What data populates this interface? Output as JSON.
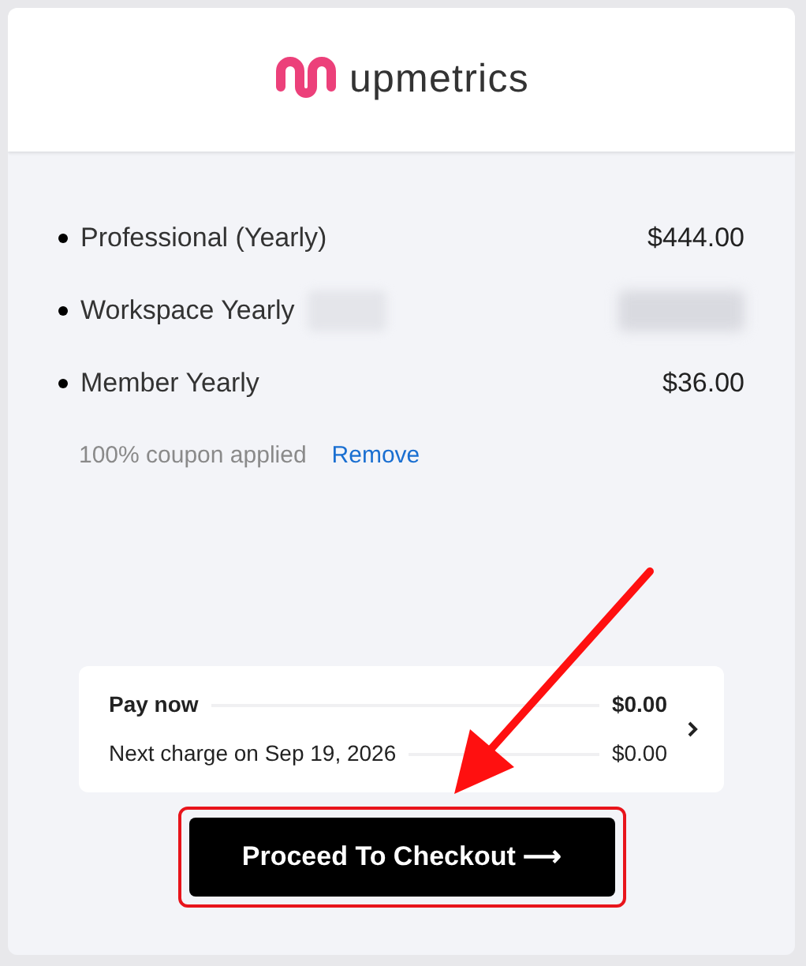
{
  "logo": {
    "text": "upmetrics"
  },
  "items": [
    {
      "name": "Professional (Yearly)",
      "price": "$444.00",
      "redacted": false
    },
    {
      "name": "Workspace Yearly",
      "redacted": true
    },
    {
      "name": "Member Yearly",
      "price": "$36.00",
      "redacted": false
    }
  ],
  "coupon": {
    "text": "100% coupon applied",
    "link": "Remove"
  },
  "summary": {
    "rows": [
      {
        "label": "Pay now",
        "amount": "$0.00",
        "bold": true
      },
      {
        "label": "Next charge on Sep 19, 2026",
        "amount": "$0.00",
        "bold": false
      }
    ]
  },
  "checkout_button": {
    "label": "Proceed To Checkout ⟶",
    "highlighted": true
  }
}
